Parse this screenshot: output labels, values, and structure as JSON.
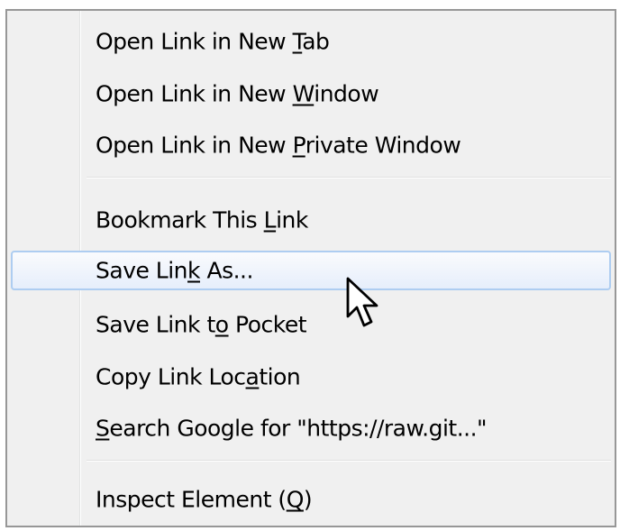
{
  "menu": {
    "items": [
      {
        "pre": "Open Link in New ",
        "key": "T",
        "post": "ab"
      },
      {
        "pre": "Open Link in New ",
        "key": "W",
        "post": "indow"
      },
      {
        "pre": "Open Link in New ",
        "key": "P",
        "post": "rivate Window"
      },
      {
        "pre": "Bookmark This ",
        "key": "L",
        "post": "ink"
      },
      {
        "pre": "Save Lin",
        "key": "k",
        "post": " As..."
      },
      {
        "pre": "Save Link t",
        "key": "o",
        "post": " Pocket"
      },
      {
        "pre": "Copy Link Loc",
        "key": "a",
        "post": "tion"
      },
      {
        "pre": "",
        "key": "S",
        "post": "earch Google for \"https://raw.git...\""
      },
      {
        "pre": "Inspect Element (",
        "key": "Q",
        "post": ")"
      }
    ],
    "highlighted_index": 4
  },
  "colors": {
    "menu_background": "#f0f0f0",
    "border": "#979797",
    "highlight_border": "#aecdf1",
    "highlight_fill": "#e6eefb"
  },
  "icons": {
    "cursor": "arrow-pointer-icon"
  }
}
